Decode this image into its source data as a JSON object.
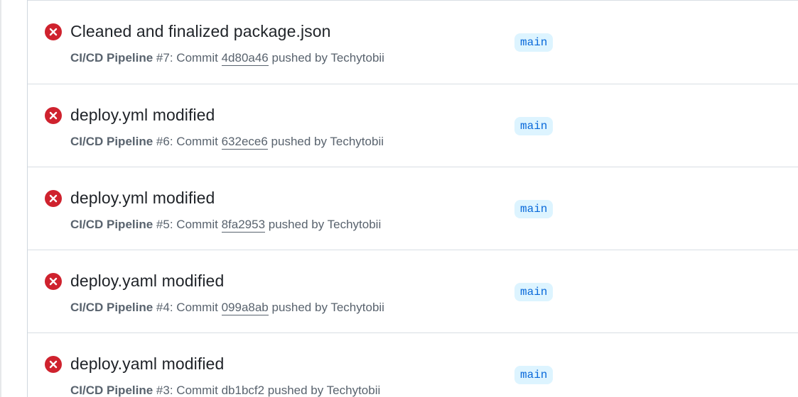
{
  "colors": {
    "failure": "#cf222e",
    "branch_bg": "#ddf4ff",
    "branch_fg": "#0969da",
    "muted": "#59636e",
    "title": "#1f2328"
  },
  "runs": [
    {
      "status_icon": "x-circle-fill-icon",
      "title": "Cleaned and finalized package.json",
      "workflow": "CI/CD Pipeline",
      "run_number": "#7",
      "commit_prefix": ": Commit ",
      "commit": "4d80a46",
      "pushed_by": " pushed by Techytobii",
      "branch": "main"
    },
    {
      "status_icon": "x-circle-fill-icon",
      "title": "deploy.yml modified",
      "workflow": "CI/CD Pipeline",
      "run_number": "#6",
      "commit_prefix": ": Commit ",
      "commit": "632ece6",
      "pushed_by": " pushed by Techytobii",
      "branch": "main"
    },
    {
      "status_icon": "x-circle-fill-icon",
      "title": "deploy.yml modified",
      "workflow": "CI/CD Pipeline",
      "run_number": "#5",
      "commit_prefix": ": Commit ",
      "commit": "8fa2953",
      "pushed_by": " pushed by Techytobii",
      "branch": "main"
    },
    {
      "status_icon": "x-circle-fill-icon",
      "title": "deploy.yaml modified",
      "workflow": "CI/CD Pipeline",
      "run_number": "#4",
      "commit_prefix": ": Commit ",
      "commit": "099a8ab",
      "pushed_by": " pushed by Techytobii",
      "branch": "main"
    },
    {
      "status_icon": "x-circle-fill-icon",
      "title": "deploy.yaml modified",
      "workflow": "CI/CD Pipeline",
      "run_number": "#3",
      "commit_prefix": ": Commit ",
      "commit": "db1bcf2",
      "pushed_by": " pushed by Techytobii",
      "branch": "main"
    }
  ]
}
